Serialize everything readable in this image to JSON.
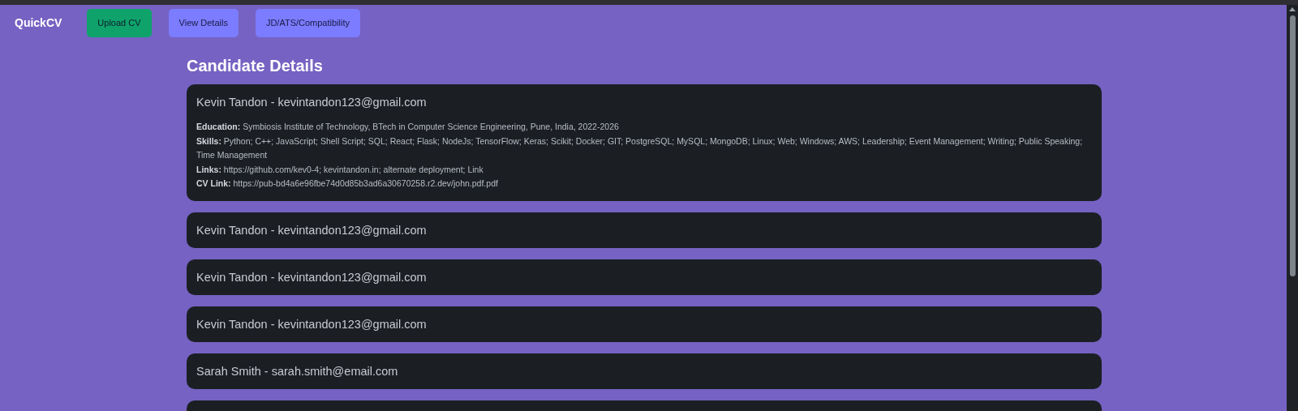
{
  "brand": "QuickCV",
  "nav": [
    {
      "label": "Upload CV",
      "kind": "primary"
    },
    {
      "label": "View Details",
      "kind": "secondary"
    },
    {
      "label": "JD/ATS/Compatibility",
      "kind": "secondary"
    }
  ],
  "heading": "Candidate Details",
  "candidates": [
    {
      "title": "Kevin Tandon - kevintandon123@gmail.com",
      "expanded": true,
      "details": [
        {
          "label": "Education:",
          "value": "Symbiosis Institute of Technology, BTech in Computer Science Engineering, Pune, India, 2022-2026"
        },
        {
          "label": "Skills:",
          "value": "Python; C++; JavaScript; Shell Script; SQL; React; Flask; NodeJs; TensorFlow; Keras; Scikit; Docker; GIT; PostgreSQL; MySQL; MongoDB; Linux; Web; Windows; AWS; Leadership; Event Management; Writing; Public Speaking; Time Management"
        },
        {
          "label": "Links:",
          "value": "https://github.com/kev0-4; kevintandon.in; alternate deployment; Link"
        },
        {
          "label": "CV Link:",
          "value": "https://pub-bd4a6e96fbe74d0d85b3ad6a30670258.r2.dev/john.pdf.pdf"
        }
      ]
    },
    {
      "title": "Kevin Tandon - kevintandon123@gmail.com",
      "expanded": false
    },
    {
      "title": "Kevin Tandon - kevintandon123@gmail.com",
      "expanded": false
    },
    {
      "title": "Kevin Tandon - kevintandon123@gmail.com",
      "expanded": false
    },
    {
      "title": "Sarah Smith - sarah.smith@email.com",
      "expanded": false
    },
    {
      "expanded": false
    }
  ]
}
